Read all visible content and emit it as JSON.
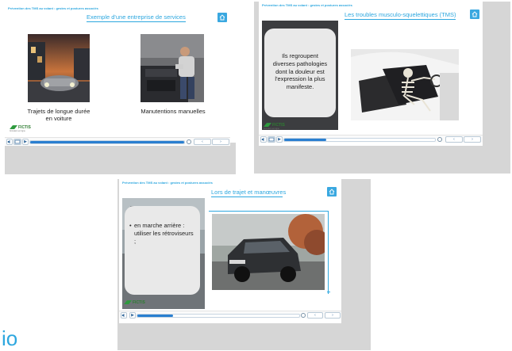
{
  "slides": [
    {
      "breadcrumb": "Prévention des TMS au volant : gestes et postures associés",
      "title": "Exemple d'une entreprise de services",
      "captions": [
        "Trajets de longue durée en voiture",
        "Manutentions manuelles"
      ],
      "logo": "FICTIS",
      "progress": 1.0
    },
    {
      "breadcrumb": "Prévention des TMS au volant : gestes et postures associés",
      "title": "Les troubles musculo-squelettiques (TMS)",
      "bubble_text": "Ils regroupent diverses pathologies dont la douleur est l'expression la plus manifeste.",
      "logo": "FICTIS",
      "progress": 0.28
    },
    {
      "breadcrumb": "Prévention des TMS au volant : gestes et postures associés",
      "title": "Lors de trajet et manœuvres",
      "bubble_bullet": "•",
      "bubble_text": "en marche arrière : utiliser les rétroviseurs ;",
      "logo": "FICTIS",
      "progress": 0.22
    }
  ],
  "logo_sub": "formation en ligne",
  "player": {
    "prev": "‹",
    "next": "›",
    "play": "▶"
  },
  "partial_text": "io",
  "colors": {
    "accent": "#2da7df",
    "panel_gray": "#d6d6d6",
    "progress_fill": "#2a7fd0",
    "logo_green": "#2e9a3e"
  },
  "icons": [
    "home-icon",
    "play-icon",
    "subtitles-icon",
    "volume-icon",
    "reload-icon"
  ]
}
